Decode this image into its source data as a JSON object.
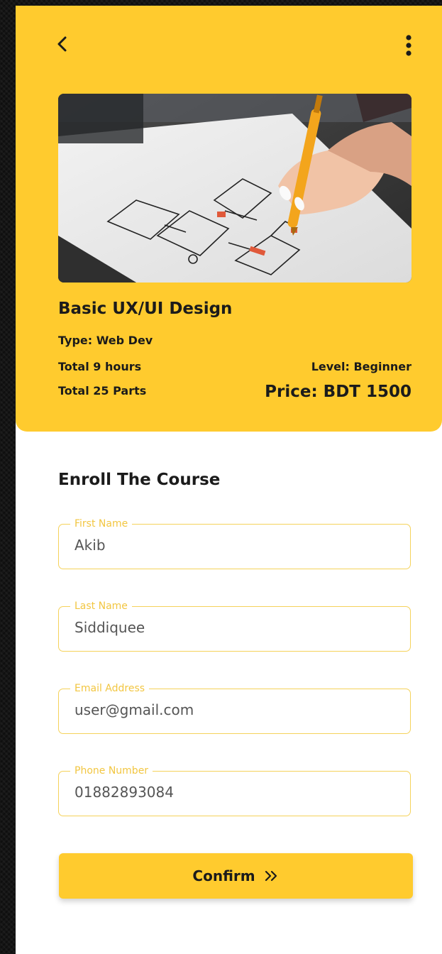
{
  "header": {
    "back_icon": "chevron-left-icon",
    "menu_icon": "more-vertical-icon"
  },
  "course": {
    "image_description": "course-thumbnail",
    "title": "Basic UX/UI Design",
    "type": "Type: Web Dev",
    "hours": "Total 9 hours",
    "parts": "Total 25 Parts",
    "level": "Level: Beginner",
    "price": "Price: BDT 1500"
  },
  "enroll": {
    "title": "Enroll The Course",
    "fields": [
      {
        "label": "First Name",
        "value": "Akib"
      },
      {
        "label": "Last Name",
        "value": "Siddiquee"
      },
      {
        "label": "Email Address",
        "value": "user@gmail.com"
      },
      {
        "label": "Phone Number",
        "value": "01882893084"
      }
    ],
    "confirm_label": "Confirm",
    "confirm_icon": "double-chevron-right-icon"
  },
  "colors": {
    "accent": "#FFCB2E",
    "field_border": "#F5D25A",
    "field_label": "#F2C641",
    "text": "#1B1B1B",
    "input_text": "#555555"
  }
}
